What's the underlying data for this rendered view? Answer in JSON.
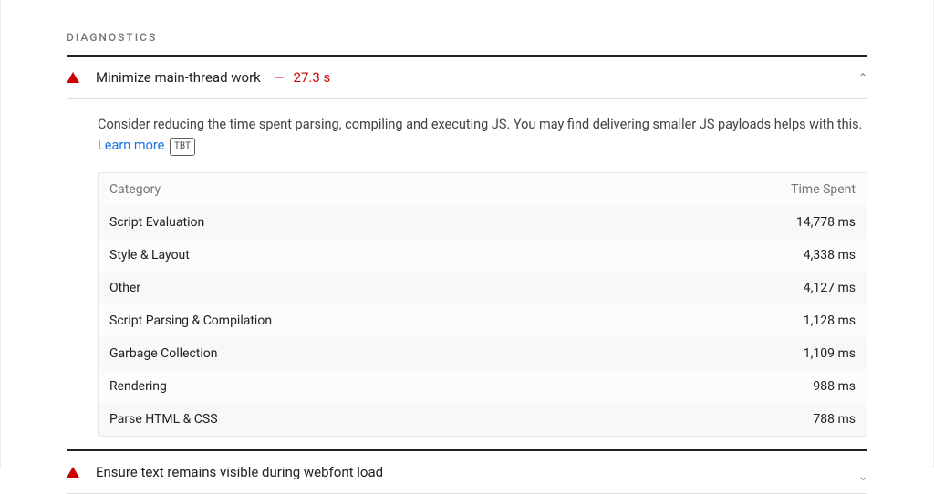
{
  "section": {
    "label": "DIAGNOSTICS"
  },
  "audit1": {
    "title": "Minimize main-thread work",
    "dash": "—",
    "value": "27.3 s",
    "description_pre": "Consider reducing the time spent parsing, compiling and executing JS. You may find delivering smaller JS payloads helps with this. ",
    "learn_more": "Learn more",
    "tbt_badge": "TBT",
    "table": {
      "headers": {
        "category": "Category",
        "time_spent": "Time Spent"
      },
      "rows": [
        {
          "category": "Script Evaluation",
          "time": "14,778 ms"
        },
        {
          "category": "Style & Layout",
          "time": "4,338 ms"
        },
        {
          "category": "Other",
          "time": "4,127 ms"
        },
        {
          "category": "Script Parsing & Compilation",
          "time": "1,128 ms"
        },
        {
          "category": "Garbage Collection",
          "time": "1,109 ms"
        },
        {
          "category": "Rendering",
          "time": "988 ms"
        },
        {
          "category": "Parse HTML & CSS",
          "time": "788 ms"
        }
      ]
    }
  },
  "audit2": {
    "title": "Ensure text remains visible during webfont load"
  }
}
